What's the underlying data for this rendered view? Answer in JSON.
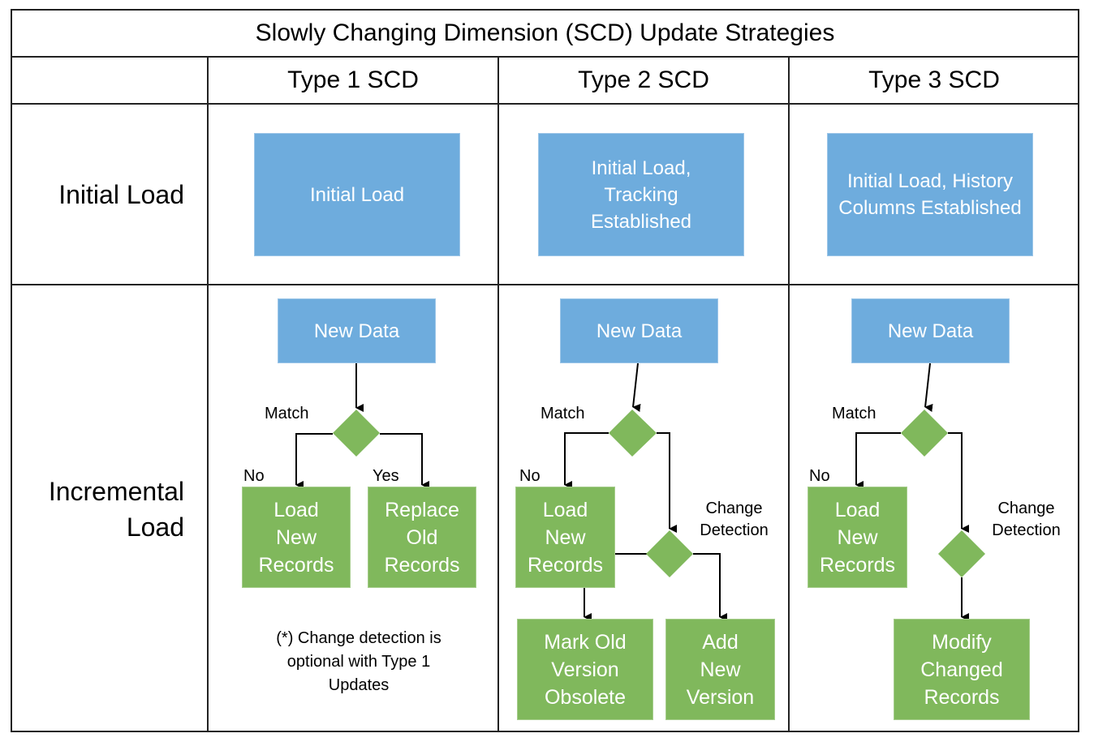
{
  "title": "Slowly Changing Dimension (SCD) Update Strategies",
  "columns": [
    "Type 1 SCD",
    "Type 2 SCD",
    "Type 3 SCD"
  ],
  "rows": [
    "Initial Load",
    "Incremental\nLoad"
  ],
  "colors": {
    "blue_box": "#6eacdd",
    "green_box": "#80b85c",
    "border": "#222222"
  },
  "initial_load": {
    "type1": "Initial Load",
    "type2": "Initial Load, Tracking Established",
    "type3": "Initial Load, History Columns Established"
  },
  "type1": {
    "new_data": "New Data",
    "match_label": "Match",
    "no_label": "No",
    "yes_label": "Yes",
    "load_new": "Load New Records",
    "replace_old": "Replace Old Records",
    "note": "(*) Change detection is optional with Type 1 Updates"
  },
  "type2": {
    "new_data": "New Data",
    "match_label": "Match",
    "no_label": "No",
    "change_label": "Change Detection",
    "load_new": "Load New Records",
    "mark_old": "Mark Old Version Obsolete",
    "add_new": "Add New Version"
  },
  "type3": {
    "new_data": "New Data",
    "match_label": "Match",
    "no_label": "No",
    "change_label": "Change Detection",
    "load_new": "Load New Records",
    "modify": "Modify Changed Records"
  }
}
